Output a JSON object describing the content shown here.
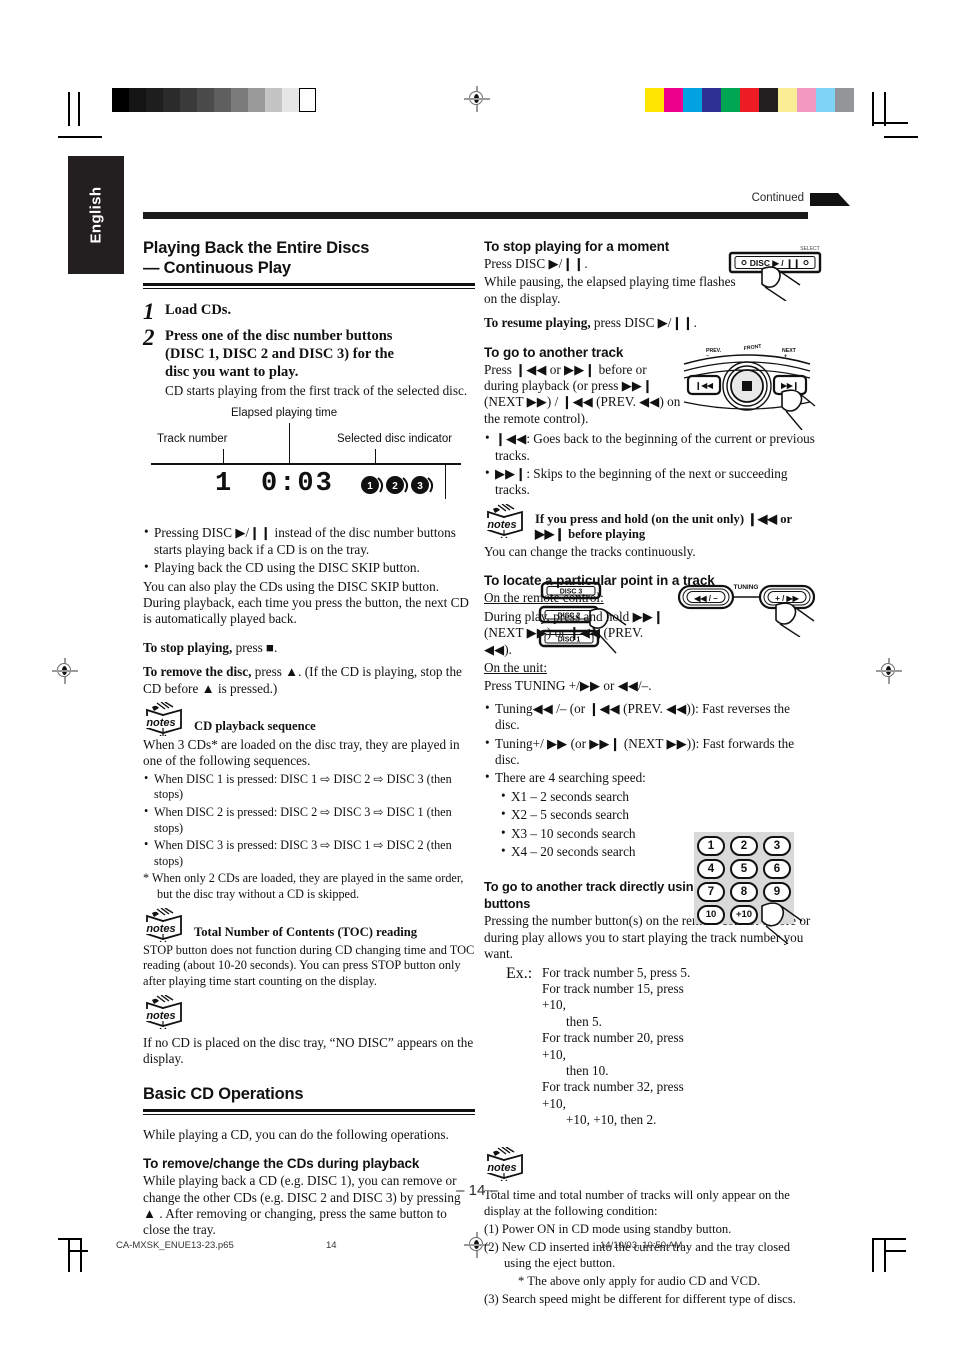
{
  "meta": {
    "language_tab": "English",
    "continued_label": "Continued",
    "page_number": "– 14 –"
  },
  "footer": {
    "filename": "CA-MXSK_ENUE13-23.p65",
    "page": "14",
    "timestamp": "14/10/03, 10:50 AM"
  },
  "calibration": {
    "grey_steps": [
      "#000000",
      "#141414",
      "#1e1e1e",
      "#2b2b2b",
      "#3a3a3a",
      "#4b4b4b",
      "#5f5f5f",
      "#7b7b7b",
      "#9a9a9a",
      "#c4c4c4",
      "#e6e6e6",
      "#ffffff"
    ],
    "color_steps": [
      "#ffe600",
      "#ec008c",
      "#00a3e0",
      "#2e3192",
      "#00a651",
      "#ed1c24",
      "#231f20",
      "#fbed96",
      "#f49ac1",
      "#7fd4f5",
      "#939598"
    ]
  },
  "left_column": {
    "heading_line1": "Playing Back the Entire Discs",
    "heading_line2": "— Continuous Play",
    "steps": [
      {
        "num": "1",
        "lead": "Load CDs.",
        "detail": ""
      },
      {
        "num": "2",
        "lead": "Press one of the disc number buttons (DISC 1, DISC 2 and DISC 3) for the disc you want to play.",
        "detail": "CD starts playing from the first track of the selected disc."
      }
    ],
    "disc_buttons": [
      "DISC 3",
      "DISC 2",
      "DISC 1"
    ],
    "display_figure": {
      "label_track": "Track number",
      "label_elapsed": "Elapsed playing time",
      "label_disc": "Selected disc indicator",
      "track_value": "1",
      "time_value": "0:03",
      "disc_indicators": [
        "1",
        "2",
        "3"
      ]
    },
    "bullets_after_figure": [
      "Pressing DISC ▶/❙❙ instead of the disc number buttons starts playing back if a CD is on the tray.",
      "Playing back the CD using the DISC SKIP button."
    ],
    "paragraph_skip": "You can also play the CDs using the DISC SKIP button. During playback, each time you press the button, the next CD is automatically played back.",
    "stop_playing_bold": "To stop playing,",
    "stop_playing_rest": " press ■.",
    "remove_disc_bold": "To remove the disc,",
    "remove_disc_rest": " press ▲. (If the CD is playing, stop the CD before ▲ is pressed.)",
    "note_sequence": {
      "title": "CD playback sequence",
      "intro": "When 3 CDs* are loaded on the disc tray, they are played in one of the following sequences.",
      "items": [
        "When DISC 1 is pressed: DISC 1 ⇨ DISC 2 ⇨ DISC 3 (then stops)",
        "When DISC 2 is pressed: DISC 2 ⇨ DISC 3 ⇨ DISC 1 (then stops)",
        "When DISC 3 is pressed: DISC 3 ⇨ DISC 1 ⇨ DISC 2 (then stops)"
      ],
      "footnote": "* When only 2 CDs are loaded, they are played in the same order, but the disc tray without a CD is skipped."
    },
    "note_toc": {
      "title": "Total Number of Contents (TOC) reading",
      "body": "STOP button does not function during CD changing time and TOC reading (about 10-20 seconds). You can press STOP button only after playing time start counting on the display."
    },
    "note_nodisc": {
      "title": "",
      "body": "If no CD is placed on the disc tray, “NO DISC” appears on the display."
    },
    "basic_heading": "Basic CD Operations",
    "basic_intro": "While playing a CD, you can do the following operations.",
    "remove_change_heading": "To remove/change the CDs during playback",
    "remove_change_body": "While playing back a CD (e.g. DISC 1), you can remove or change the other CDs (e.g. DISC 2 and DISC 3) by pressing ▲ . After removing or changing, press the same button to close the tray."
  },
  "right_column": {
    "stop_moment": {
      "heading": "To stop playing for a moment",
      "line1": "Press DISC ▶/❙❙.",
      "line2": "While pausing, the elapsed playing time flashes on the display.",
      "resume_bold": "To resume playing,",
      "resume_rest": " press DISC ▶/❙❙."
    },
    "disc_play_button": {
      "select_label": "SELECT",
      "label": "DISC ▶/❙❙"
    },
    "another_track": {
      "heading": "To go to another track",
      "body": "Press ❙◀◀ or ▶▶❙ before or during playback (or press ▶▶❙ (NEXT ▶▶) / ❙◀◀ (PREV. ◀◀) on the remote control).",
      "bullets": [
        "❙◀◀: Goes back to the beginning of the current or previous tracks.",
        "▶▶❙: Skips to the beginning of the next or succeeding tracks."
      ]
    },
    "jog_art": {
      "prev": "PREV.",
      "front": "FRONT",
      "next": "NEXT",
      "next_sign": "+",
      "prev_sign": "–"
    },
    "note_hold": {
      "title": "If you press and hold (on the unit only) ❙◀◀ or ▶▶❙ before playing",
      "body": "You can change the tracks continuously."
    },
    "locate_point": {
      "heading": "To locate a particular point in a track",
      "remote_label": "On the remote control:",
      "remote_body": "During play, press and hold ▶▶❙ (NEXT ▶▶) or ❙◀◀ (PREV. ◀◀).",
      "unit_label": "On the unit:",
      "unit_body": "Press TUNING +/▶▶  or ◀◀/–.",
      "bullets": [
        "Tuning◀◀ /– (or ❙◀◀ (PREV. ◀◀)): Fast reverses the disc.",
        "Tuning+/ ▶▶ (or ▶▶❙ (NEXT ▶▶)): Fast forwards the disc.",
        "There are 4 searching speed:"
      ],
      "speeds": [
        "X1 – 2 seconds search",
        "X2 – 5 seconds search",
        "X3 – 10 seconds search",
        "X4 – 20 seconds search"
      ]
    },
    "tuning_art": {
      "left_label": "◀◀ / –",
      "center_label": "TUNING",
      "right_label": "+ / ▶▶"
    },
    "number_buttons": {
      "heading": "To go to another track directly using the number buttons",
      "body": "Pressing the number button(s) on the remote control before or during play allows you to start playing the track number you want.",
      "ex_label": "Ex.:",
      "examples": [
        "For track number 5, press 5.",
        "For track number 15, press +10,",
        "then 5.",
        "For track number 20, press +10,",
        "then 10.",
        "For track number 32, press +10,",
        "+10, +10, then 2."
      ],
      "keys": [
        "1",
        "2",
        "3",
        "4",
        "5",
        "6",
        "7",
        "8",
        "9",
        "10",
        "+10"
      ]
    },
    "note_total": {
      "body": "Total time and total number of tracks will only appear on the display at the following condition:",
      "items": [
        "(1) Power ON in CD mode using standby button.",
        "(2) New CD inserted into the current tray and the tray closed using the eject button.",
        "* The above only apply for audio CD and VCD.",
        "(3) Search speed might be different for different type of discs."
      ]
    }
  }
}
